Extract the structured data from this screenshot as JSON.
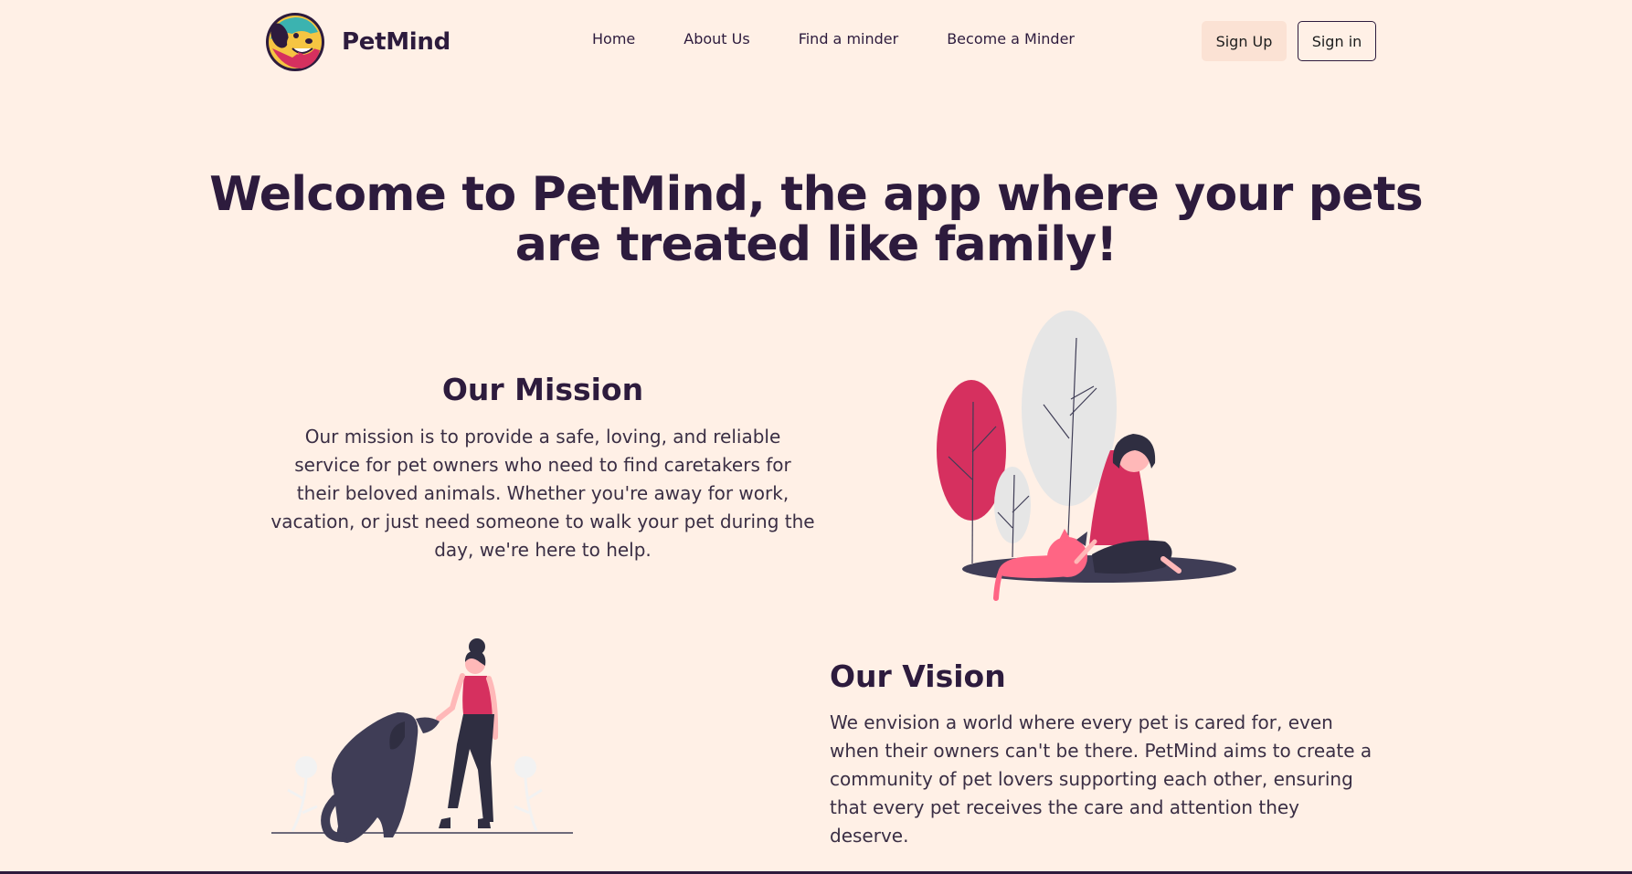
{
  "brand": {
    "name": "PetMind",
    "logo_icon": "dog-face-logo-icon"
  },
  "nav": {
    "links": [
      "Home",
      "About Us",
      "Find a minder",
      "Become a Minder"
    ],
    "signup_label": "Sign Up",
    "signin_label": "Sign in"
  },
  "hero": {
    "line1": "Welcome to PetMind, the app where your pets",
    "line2": "are treated like family!"
  },
  "mission": {
    "title": "Our Mission",
    "text": "Our mission is to provide a safe, loving, and reliable service for pet owners who need to find caretakers for their beloved animals. Whether you're away for work, vacation, or just need someone to walk your pet during the day, we're here to help."
  },
  "vision": {
    "title": "Our Vision",
    "text": "We envision a world where every pet is cared for, even when their owners can't be there. PetMind aims to create a community of pet lovers supporting each other, ensuring that every pet receives the care and attention they deserve."
  },
  "colors": {
    "background": "#fff0e6",
    "primary_text": "#2d1b3d",
    "accent_pink": "#d6305f",
    "signup_bg": "#fbe2d4",
    "illustration_dark": "#3f3d56"
  }
}
